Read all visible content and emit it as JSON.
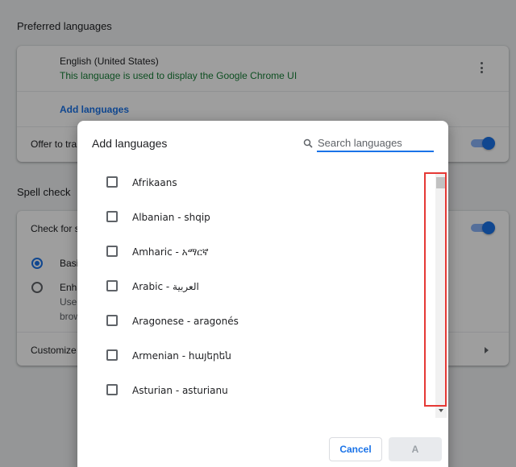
{
  "background": {
    "preferred_title": "Preferred languages",
    "language_name": "English (United States)",
    "language_note": "This language is used to display the Google Chrome UI",
    "add_languages_link": "Add languages",
    "offer_translate": "Offer to tra",
    "spell_check_title": "Spell check",
    "check_for": "Check for s",
    "basic_label": "Basi",
    "enhanced_label": "Enha",
    "enhanced_line2": "Use",
    "enhanced_line3": "brow",
    "customize_label": "Customize"
  },
  "dialog": {
    "title": "Add languages",
    "search_placeholder": "Search languages",
    "search_value": "",
    "languages": [
      "Afrikaans",
      "Albanian - shqip",
      "Amharic - አማርኛ",
      "Arabic - العربية",
      "Aragonese - aragonés",
      "Armenian - հայերեն",
      "Asturian - asturianu"
    ],
    "cancel_label": "Cancel",
    "add_label": "A"
  },
  "colors": {
    "accent": "#1a73e8",
    "note_green": "#188038",
    "highlight_red": "#e53935"
  }
}
